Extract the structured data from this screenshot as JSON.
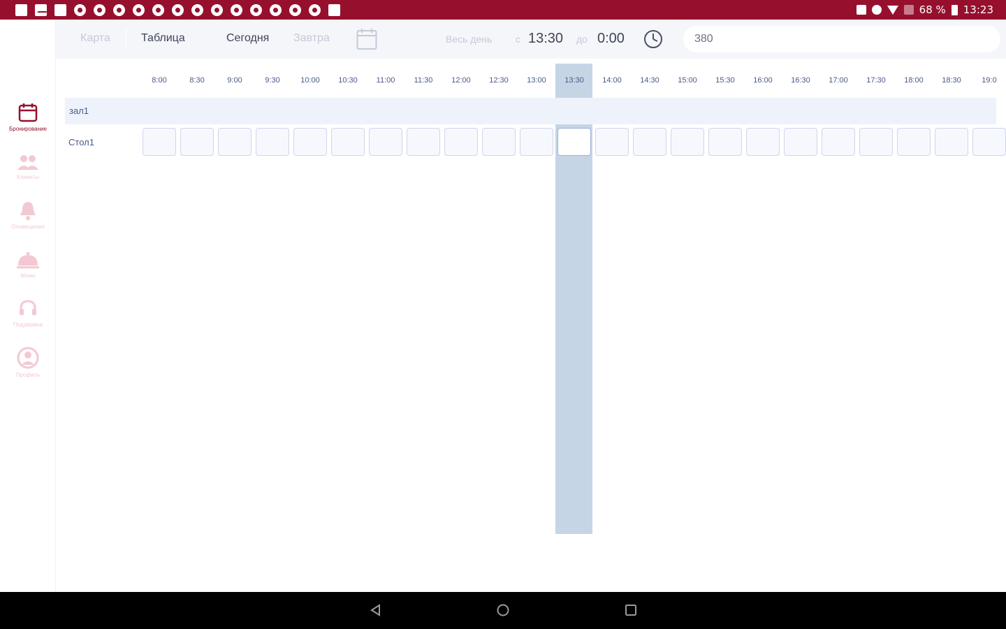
{
  "statusbar": {
    "battery_text": "68 %",
    "time": "13:23",
    "notification_icons": [
      "photo-icon",
      "mail-icon",
      "square-icon",
      "chrome-icon",
      "chrome-icon",
      "chrome-icon",
      "chrome-icon",
      "chrome-icon",
      "chrome-icon",
      "chrome-icon",
      "chrome-icon",
      "chrome-icon",
      "chrome-icon",
      "chrome-icon",
      "chrome-icon",
      "chrome-icon",
      "bag-icon"
    ]
  },
  "sidebar": {
    "items": [
      {
        "label": "Бронирование",
        "icon": "calendar-icon",
        "active": true
      },
      {
        "label": "Клиенты",
        "icon": "people-icon",
        "active": false
      },
      {
        "label": "Оповещения",
        "icon": "bell-icon",
        "active": false
      },
      {
        "label": "Меню",
        "icon": "cloche-icon",
        "active": false
      },
      {
        "label": "Поддержка",
        "icon": "headset-icon",
        "active": false
      },
      {
        "label": "Профиль",
        "icon": "profile-icon",
        "active": false
      }
    ]
  },
  "toolbar": {
    "map_label": "Карта",
    "table_label": "Таблица",
    "today_label": "Сегодня",
    "tomorrow_label": "Завтра",
    "all_day_label": "Весь день",
    "from_label": "с",
    "from_time": "13:30",
    "to_label": "до",
    "to_time": "0:00",
    "search_value": "380"
  },
  "grid": {
    "time_slots": [
      "8:00",
      "8:30",
      "9:00",
      "9:30",
      "10:00",
      "10:30",
      "11:00",
      "11:30",
      "12:00",
      "12:30",
      "13:00",
      "13:30",
      "14:00",
      "14:30",
      "15:00",
      "15:30",
      "16:00",
      "16:30",
      "17:00",
      "17:30",
      "18:00",
      "18:30",
      "19:0"
    ],
    "selected_slot": "13:30",
    "hall_name": "зал1",
    "rows": [
      {
        "name": "Стол1"
      }
    ]
  },
  "colors": {
    "brand": "#96102e",
    "highlight": "#c5d5e6",
    "toolbar_bg": "#f4f6fa"
  }
}
